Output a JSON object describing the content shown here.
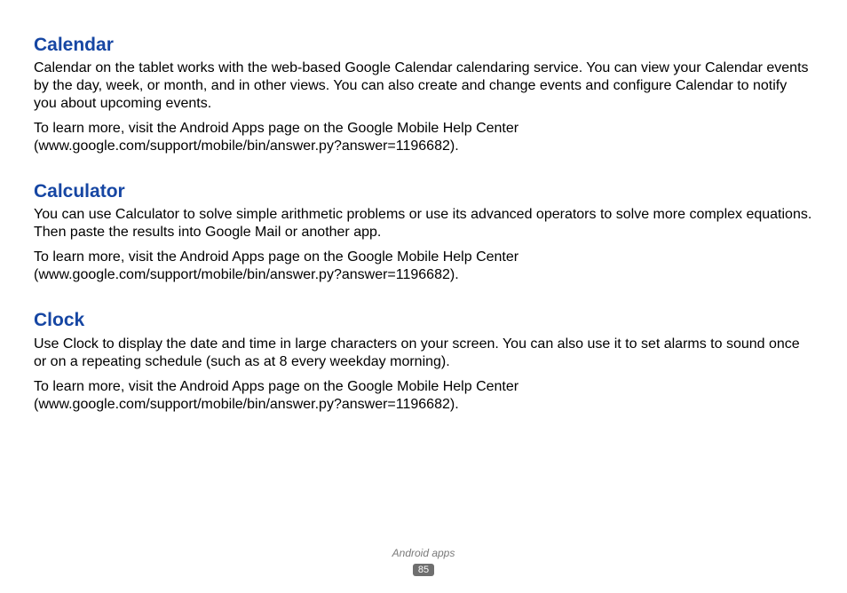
{
  "sections": [
    {
      "heading": "Calendar",
      "paragraphs": [
        "Calendar on the tablet works with the web-based Google Calendar calendaring service. You can view your Calendar events by the day, week, or month, and in other views. You can also create and change events and configure Calendar to notify you about upcoming events.",
        "To learn more, visit the Android Apps page on the Google Mobile Help Center (www.google.com/support/mobile/bin/answer.py?answer=1196682)."
      ]
    },
    {
      "heading": "Calculator",
      "paragraphs": [
        "You can use Calculator to solve simple arithmetic problems or use its advanced operators to solve more complex equations. Then paste the results into Google Mail or another app.",
        "To learn more, visit the Android Apps page on the Google Mobile Help Center (www.google.com/support/mobile/bin/answer.py?answer=1196682)."
      ]
    },
    {
      "heading": "Clock",
      "paragraphs": [
        "Use Clock to display the date and time in large characters on your screen. You can also use it to set alarms to sound once or on a repeating schedule (such as at 8 every weekday morning).",
        "To learn more, visit the Android Apps page on the Google Mobile Help Center (www.google.com/support/mobile/bin/answer.py?answer=1196682)."
      ]
    }
  ],
  "footer": {
    "chapter": "Android apps",
    "page_number": "85"
  }
}
